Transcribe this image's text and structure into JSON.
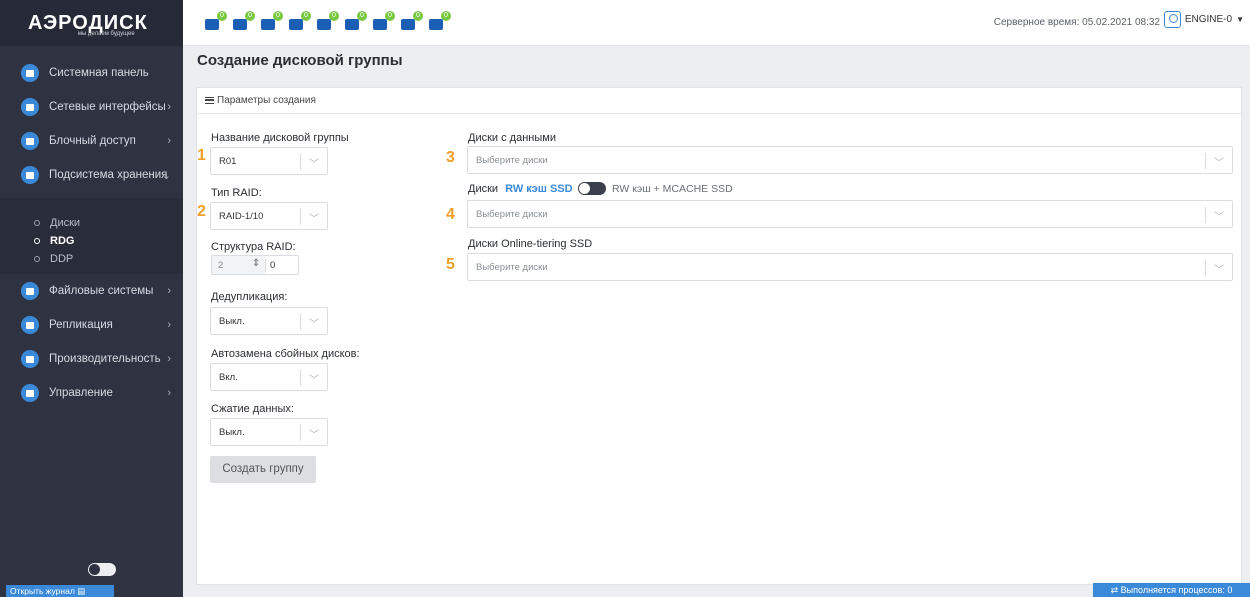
{
  "logo": {
    "brand": "АЭРОДИСК",
    "tagline": "мы делаем будущее"
  },
  "sidebar": {
    "items": [
      {
        "label": "Системная панель"
      },
      {
        "label": "Сетевые интерфейсы",
        "chevron": "›"
      },
      {
        "label": "Блочный доступ",
        "chevron": "›"
      },
      {
        "label": "Подсистема хранения",
        "chevron": "⌄"
      },
      {
        "label": "Файловые системы",
        "chevron": "›"
      },
      {
        "label": "Репликация",
        "chevron": "›"
      },
      {
        "label": "Производительность",
        "chevron": "›"
      },
      {
        "label": "Управление",
        "chevron": "›"
      }
    ],
    "subitems": [
      {
        "label": "Диски"
      },
      {
        "label": "RDG",
        "active": true
      },
      {
        "label": "DDP"
      }
    ],
    "journal_label": "Открыть журнал"
  },
  "topbar": {
    "status_icons": [
      {
        "icon": "storage-icon",
        "count": "0"
      },
      {
        "icon": "disk-icon",
        "count": "0"
      },
      {
        "icon": "network-icon",
        "count": "0"
      },
      {
        "icon": "network-ports-icon",
        "count": "0"
      },
      {
        "icon": "memory-icon",
        "count": "0"
      },
      {
        "icon": "wave-icon",
        "count": "0"
      },
      {
        "icon": "monitor-icon",
        "count": "0"
      },
      {
        "icon": "ram-icon",
        "count": "0"
      },
      {
        "icon": "sensor-icon",
        "count": "0"
      }
    ],
    "server_time": "Серверное время: 05.02.2021 08:32",
    "user": "ENGINE-0"
  },
  "page": {
    "title": "Создание дисковой группы"
  },
  "panel": {
    "header": "Параметры создания",
    "left": {
      "group_name_label": "Название дисковой группы",
      "group_name_value": "R01",
      "raid_type_label": "Тип RAID:",
      "raid_type_value": "RAID-1/10",
      "raid_struct_label": "Структура RAID:",
      "raid_struct_v1": "2",
      "raid_struct_v2": "0",
      "dedup_label": "Дедупликация:",
      "dedup_value": "Выкл.",
      "autoreplace_label": "Автозамена сбойных дисков:",
      "autoreplace_value": "Вкл.",
      "compress_label": "Сжатие данных:",
      "compress_value": "Выкл.",
      "create_button": "Создать группу"
    },
    "right": {
      "data_disks_label": "Диски с данными",
      "cache_label_prefix": "Диски",
      "cache_label_active": "RW кэш SSD",
      "cache_toggle_alt": "RW кэш + MCACHE SSD",
      "tiering_label": "Диски Online-tiering SSD",
      "placeholder": "Выберите диски"
    },
    "markers": [
      "1",
      "2",
      "3",
      "4",
      "5"
    ]
  },
  "footer": {
    "processes": "⇄ Выполняется процессов: 0"
  },
  "colors": {
    "sidebar": "#2f3341",
    "accent": "#3a8ad9",
    "marker": "#f0a02a",
    "badge": "#7ac943"
  }
}
